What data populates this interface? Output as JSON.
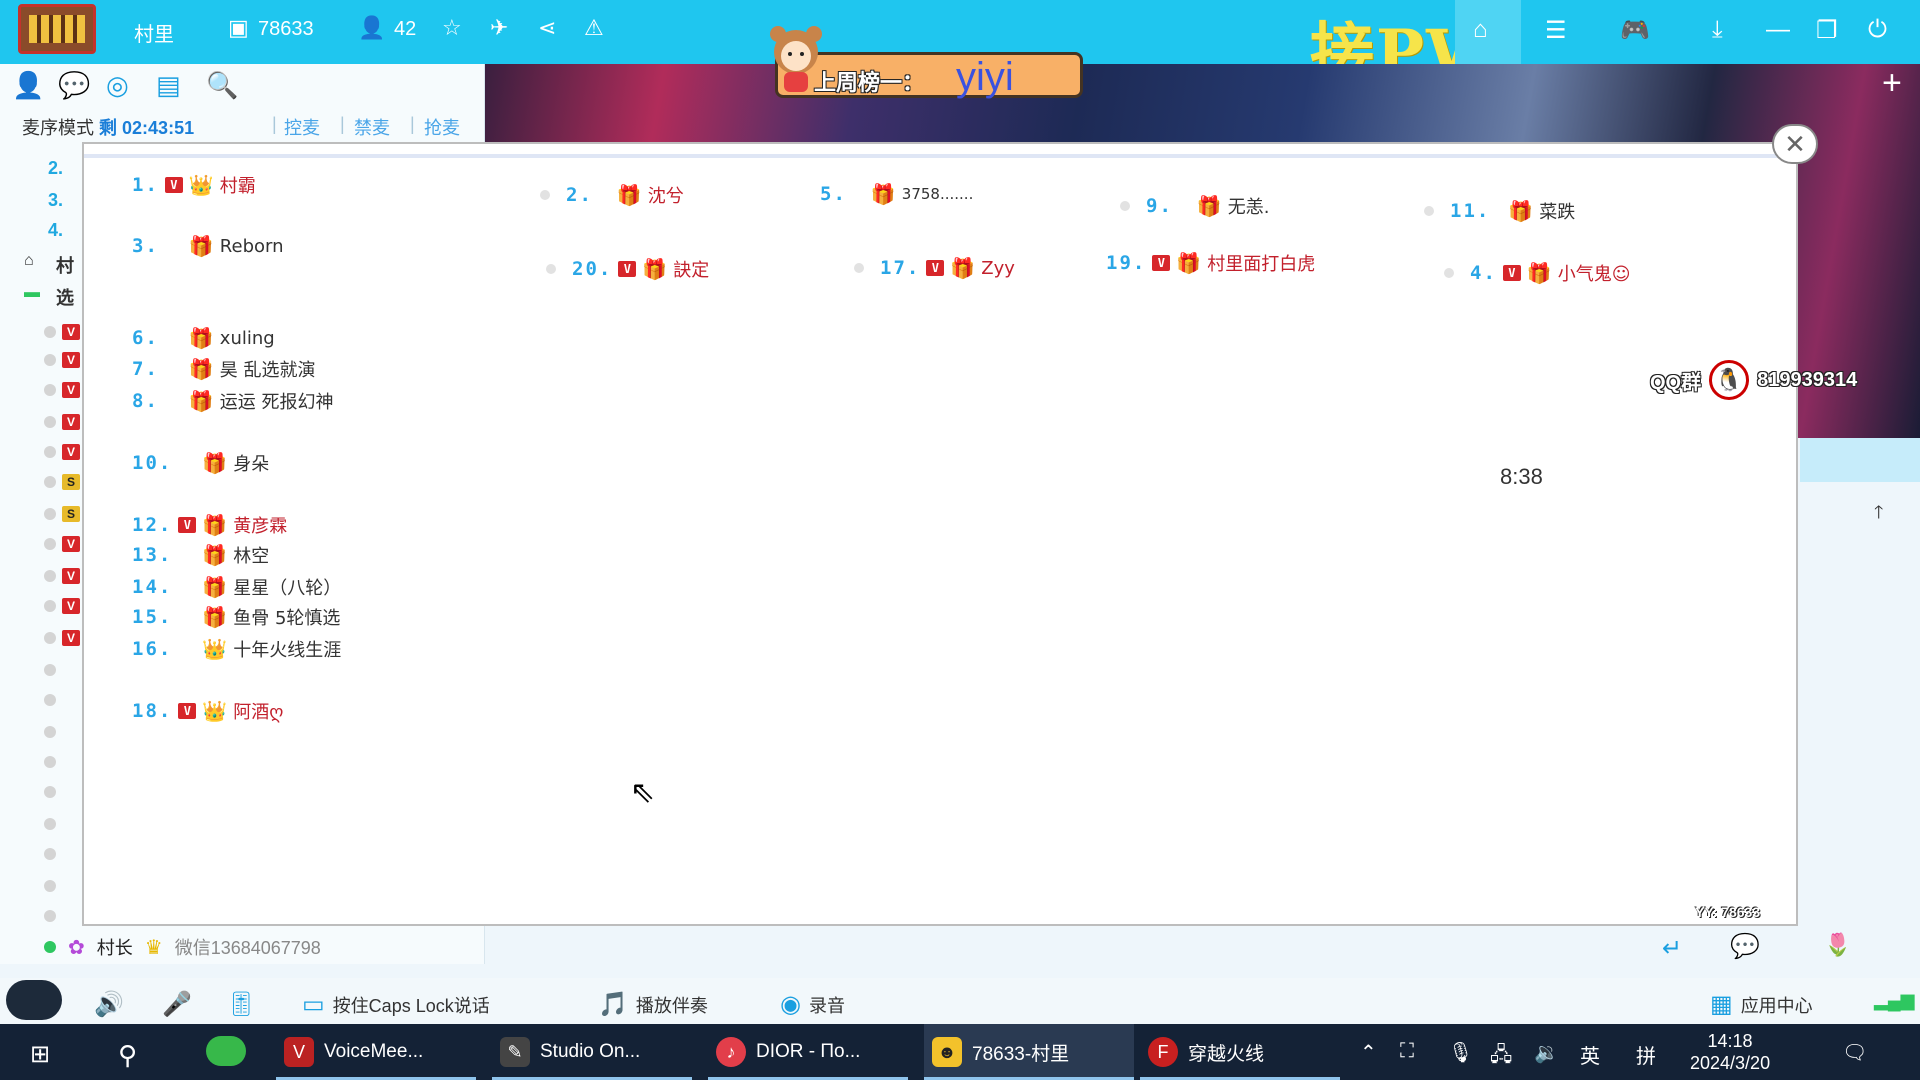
{
  "titlebar": {
    "app_name": "村里",
    "room_id": "78633",
    "online_count": "42",
    "watermark": "接PW",
    "icons": [
      "room-id-icon",
      "user-icon",
      "star-icon",
      "plane-icon",
      "share-icon",
      "report-icon",
      "home-icon",
      "list-icon",
      "gamepad-icon",
      "download-icon",
      "minimize-icon",
      "restore-icon",
      "power-icon"
    ]
  },
  "left_panel": {
    "mic_mode": "麦序模式",
    "remaining_label": "剩",
    "remaining_time": "02:43:51",
    "links": [
      "控麦",
      "禁麦",
      "抢麦"
    ],
    "ranks": [
      "2.",
      "3.",
      "4."
    ],
    "sections": [
      "村",
      "选"
    ]
  },
  "banner": {
    "weekly_top_label": "上周榜一：",
    "weekly_top_name": "yiyi"
  },
  "overlay": {
    "entries": [
      {
        "num": "1.",
        "name": "村霸",
        "vip": true,
        "style": "red"
      },
      {
        "num": "2.",
        "name": "沈兮",
        "vip": false,
        "style": "red"
      },
      {
        "num": "5.",
        "name": "3758.......",
        "vip": false,
        "style": "dark"
      },
      {
        "num": "9.",
        "name": "无恙.",
        "vip": false,
        "style": "dark"
      },
      {
        "num": "11.",
        "name": "菜跌",
        "vip": false,
        "style": "dark"
      },
      {
        "num": "3.",
        "name": "Reborn",
        "vip": false,
        "style": "dark"
      },
      {
        "num": "20.",
        "name": "訣定",
        "vip": true,
        "style": "red"
      },
      {
        "num": "17.",
        "name": "Zyy",
        "vip": true,
        "style": "red"
      },
      {
        "num": "19.",
        "name": "村里面打白虎",
        "vip": true,
        "style": "red"
      },
      {
        "num": "4.",
        "name": "小气鬼☺",
        "vip": true,
        "style": "red"
      },
      {
        "num": "6.",
        "name": "xuling",
        "vip": false,
        "style": "dark"
      },
      {
        "num": "7.",
        "name": "昊 乱选就演",
        "vip": false,
        "style": "dark"
      },
      {
        "num": "8.",
        "name": "运运 死报幻神",
        "vip": false,
        "style": "dark"
      },
      {
        "num": "10.",
        "name": "身朵",
        "vip": false,
        "style": "dark"
      },
      {
        "num": "12.",
        "name": "黄彦霖",
        "vip": true,
        "style": "red"
      },
      {
        "num": "13.",
        "name": "林空",
        "vip": false,
        "style": "dark"
      },
      {
        "num": "14.",
        "name": "星星（八轮）",
        "vip": false,
        "style": "dark"
      },
      {
        "num": "15.",
        "name": "鱼骨 5轮慎选",
        "vip": false,
        "style": "dark"
      },
      {
        "num": "16.",
        "name": "十年火线生涯",
        "vip": false,
        "style": "dark"
      },
      {
        "num": "18.",
        "name": "阿酒ღ",
        "vip": true,
        "style": "red"
      }
    ],
    "qq_label": "QQ群",
    "qq_number": "819939314",
    "code_glyph": "8:38",
    "yy_label": "YY: 78633"
  },
  "member_row": {
    "title": "村长",
    "wechat": "微信13684067798"
  },
  "bottombar": {
    "caps_label": "按住Caps Lock说话",
    "accompany_label": "播放伴奏",
    "record_label": "录音",
    "app_center": "应用中心"
  },
  "taskbar": {
    "apps": [
      {
        "label": "VoiceMee..."
      },
      {
        "label": "Studio On..."
      },
      {
        "label": "DIOR - По..."
      },
      {
        "label": "78633-村里"
      },
      {
        "label": "穿越火线"
      }
    ],
    "ime": "英",
    "ime2": "拼",
    "time": "14:18",
    "date": "2024/3/20"
  }
}
